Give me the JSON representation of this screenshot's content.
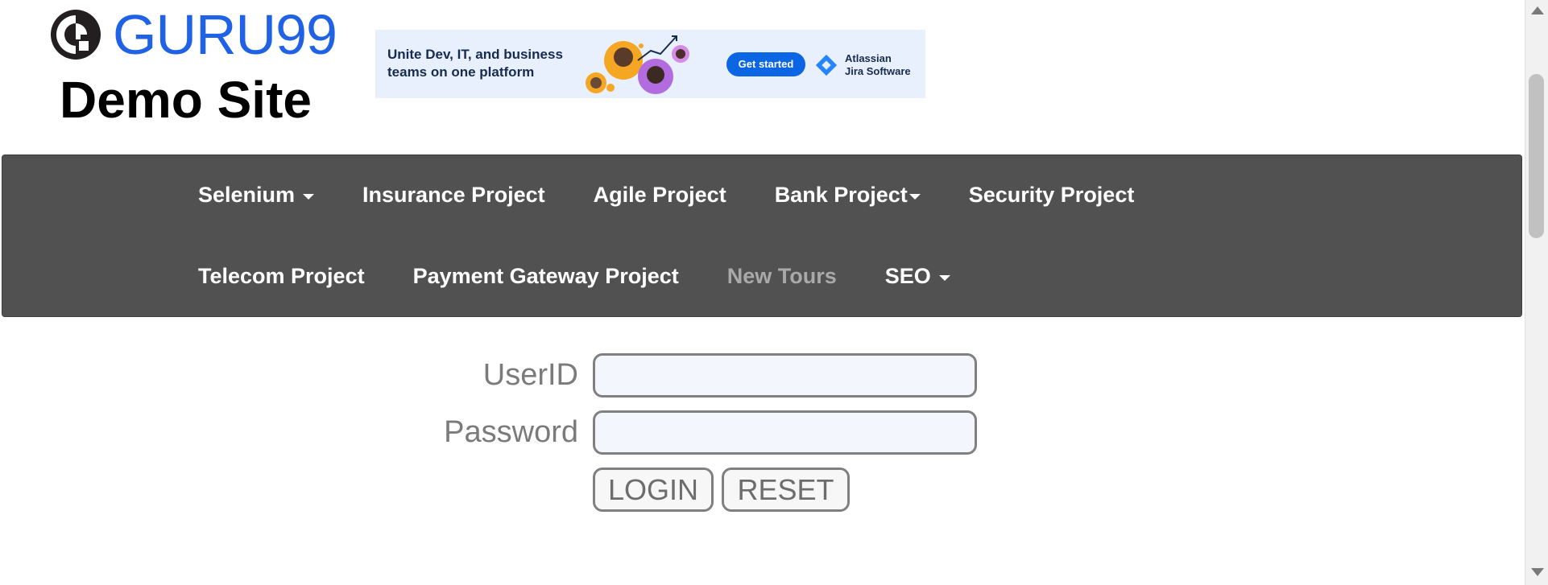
{
  "header": {
    "logo_text": "GURU99",
    "site_title": "Demo Site"
  },
  "ad": {
    "headline": "Unite Dev, IT, and business teams on one platform",
    "cta_label": "Get started",
    "brand_line1": "Atlassian",
    "brand_line2": "Jira Software"
  },
  "nav": {
    "row1": [
      {
        "label": "Selenium",
        "dropdown": true
      },
      {
        "label": "Insurance Project",
        "dropdown": false
      },
      {
        "label": "Agile Project",
        "dropdown": false
      },
      {
        "label": "Bank Project",
        "dropdown": true
      },
      {
        "label": "Security Project",
        "dropdown": false
      }
    ],
    "row2": [
      {
        "label": "Telecom Project",
        "dropdown": false
      },
      {
        "label": "Payment Gateway Project",
        "dropdown": false
      },
      {
        "label": "New Tours",
        "dropdown": false,
        "active": true
      },
      {
        "label": "SEO",
        "dropdown": true
      }
    ]
  },
  "form": {
    "userid_label": "UserID",
    "userid_value": "",
    "password_label": "Password",
    "password_value": "",
    "login_label": "LOGIN",
    "reset_label": "RESET"
  },
  "colors": {
    "brand_blue": "#1f62e6",
    "navbar_bg": "#515151",
    "nav_active": "#a9a9a9",
    "input_bg": "#f3f6fd"
  }
}
